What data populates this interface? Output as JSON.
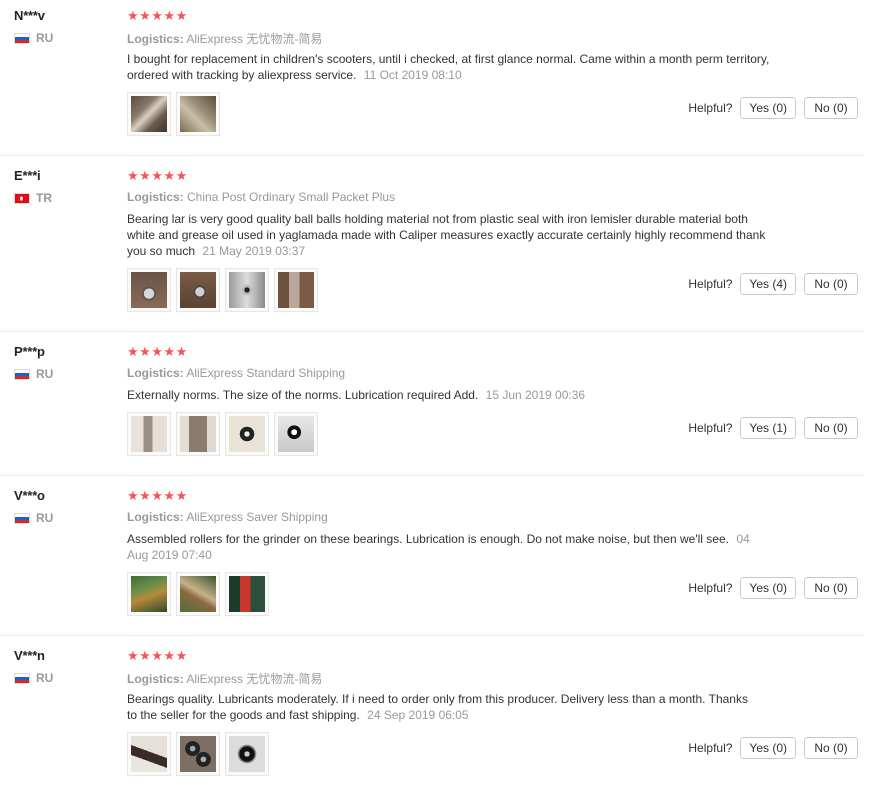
{
  "helpful_label": "Helpful?",
  "stars": "★★★★★",
  "logistics_label": "Logistics:",
  "colors": {
    "star": "#f25555",
    "muted": "#999999"
  },
  "reviews": [
    {
      "user": "N***v",
      "country": "RU",
      "flag": "ru",
      "logistics": "AliExpress 无忧物流-简易",
      "text": "I bought for replacement in children's scooters, until i checked, at first glance normal. Came within a month perm territory, ordered with tracking by aliexpress service.",
      "date": "11 Oct 2019 08:10",
      "yes": "Yes (0)",
      "no": "No (0)",
      "pictures": [
        "product-photo",
        "product-photo"
      ]
    },
    {
      "user": "E***i",
      "country": "TR",
      "flag": "tr",
      "logistics": "China Post Ordinary Small Packet Plus",
      "text": "Bearing lar is very good quality ball balls holding material not from plastic seal with iron lemisler durable material both white and grease oil used in yaglamada made with Caliper measures exactly accurate certainly highly recommend thank you so much",
      "date": "21 May 2019 03:37",
      "yes": "Yes (4)",
      "no": "No (0)",
      "pictures": [
        "product-photo",
        "product-photo",
        "product-photo",
        "product-photo"
      ]
    },
    {
      "user": "P***p",
      "country": "RU",
      "flag": "ru",
      "logistics": "AliExpress Standard Shipping",
      "text": "Externally norms. The size of the norms. Lubrication required Add.",
      "date": "15 Jun 2019 00:36",
      "yes": "Yes (1)",
      "no": "No (0)",
      "pictures": [
        "product-photo",
        "product-photo",
        "product-photo",
        "product-photo"
      ]
    },
    {
      "user": "V***o",
      "country": "RU",
      "flag": "ru",
      "logistics": "AliExpress Saver Shipping",
      "text": "Assembled rollers for the grinder on these bearings. Lubrication is enough. Do not make noise, but then we'll see.",
      "date": "04 Aug 2019 07:40",
      "yes": "Yes (0)",
      "no": "No (0)",
      "pictures": [
        "product-photo",
        "product-photo",
        "product-photo"
      ]
    },
    {
      "user": "V***n",
      "country": "RU",
      "flag": "ru",
      "logistics": "AliExpress 无忧物流-简易",
      "text": "Bearings quality. Lubricants moderately. If i need to order only from this producer. Delivery less than a month. Thanks to the seller for the goods and fast shipping.",
      "date": "24 Sep 2019 06:05",
      "yes": "Yes (0)",
      "no": "No (0)",
      "pictures": [
        "product-photo",
        "product-photo",
        "product-photo"
      ]
    }
  ]
}
